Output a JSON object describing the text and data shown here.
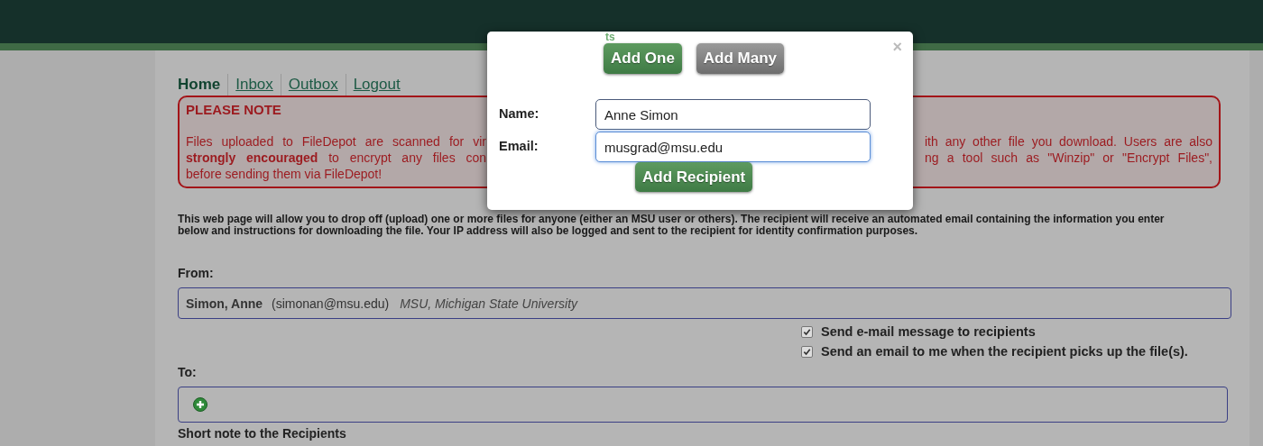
{
  "nav": {
    "tabs": [
      {
        "label": "Home",
        "selected": true
      },
      {
        "label": "Inbox",
        "selected": false
      },
      {
        "label": "Outbox",
        "selected": false
      },
      {
        "label": "Logout",
        "selected": false
      }
    ]
  },
  "notice": {
    "title": "PLEASE NOTE",
    "lines_left": [
      "Files uploaded to FileDepot are scanned for vir",
      "**strongly encouraged** to encrypt any files con",
      "before sending them via FileDepot!"
    ],
    "lines_right": [
      "ith any other file you download. Users are also",
      "ng a tool such as \"Winzip\" or \"Encrypt Files\","
    ]
  },
  "description": "This web page will allow you to drop off (upload) one or more files for anyone (either an MSU user or others). The recipient will receive an automated email containing the information you enter below and instructions for downloading the file. Your IP address will also be logged and sent to the recipient for identity confirmation purposes.",
  "from": {
    "label": "From:",
    "name": "Simon, Anne",
    "email": "(simonan@msu.edu)",
    "org": "MSU, Michigan State University"
  },
  "options": [
    {
      "label": "Send e-mail message to recipients",
      "checked": true
    },
    {
      "label": "Send an email to me when the recipient picks up the file(s).",
      "checked": true
    }
  ],
  "to": {
    "label": "To:"
  },
  "note_label": "Short note to the Recipients",
  "dialog": {
    "fragment": "ts",
    "close": "×",
    "modes": [
      {
        "label": "Add One",
        "selected": true
      },
      {
        "label": "Add Many",
        "selected": false
      }
    ],
    "fields": [
      {
        "label": "Name:",
        "value": "Anne Simon"
      },
      {
        "label": "Email:",
        "value": "musgrad@msu.edu"
      }
    ],
    "submit": "Add Recipient"
  }
}
